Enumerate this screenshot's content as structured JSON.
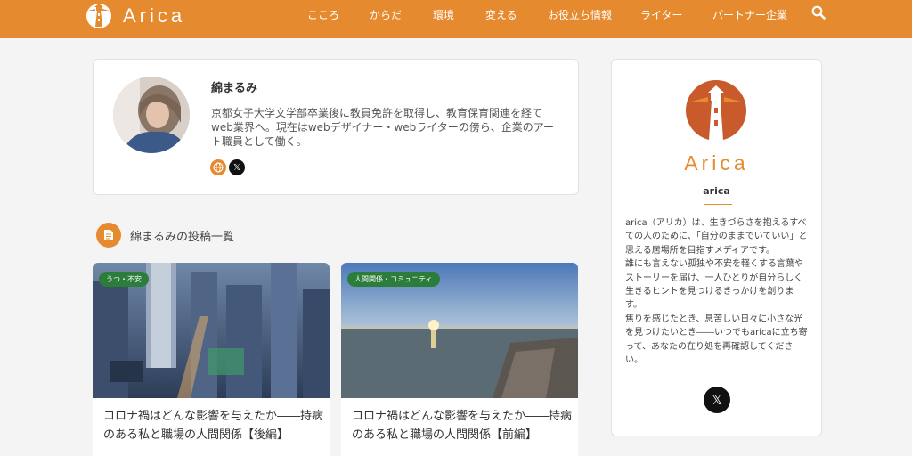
{
  "header": {
    "brand": "Arica",
    "nav": [
      "こころ",
      "からだ",
      "環境",
      "変える",
      "お役立ち情報",
      "ライター",
      "パートナー企業"
    ],
    "search_icon": "search-icon"
  },
  "author": {
    "name": "綿まるみ",
    "bio": "京都女子大学文学部卒業後に教員免許を取得し、教育保育関連を経てweb業界へ。現在はwebデザイナー・webライターの傍ら、企業のアート職員として働く。",
    "icons": [
      "globe-icon",
      "x-icon"
    ]
  },
  "posts_section": {
    "title": "綿まるみの投稿一覧",
    "icon": "document-icon"
  },
  "posts": [
    {
      "category": "うつ・不安",
      "title": "コロナ禍はどんな影響を与えたか――持病のある私と職場の人間関係【後編】"
    },
    {
      "category": "人間関係・コミュニティ",
      "title": "コロナ禍はどんな影響を与えたか――持病のある私と職場の人間関係【前編】"
    }
  ],
  "sidebar": {
    "brand": "Arica",
    "name": "arica",
    "description": "arica（アリカ）は、生きづらさを抱えるすべての人のために、「自分のままでいていい」と思える居場所を目指すメディアです。\n誰にも言えない孤独や不安を軽くする言葉やストーリーを届け、一人ひとりが自分らしく生きるヒントを見つけるきっかけを創ります。\n焦りを感じたとき、息苦しい日々に小さな光を見つけたいとき――いつでもaricaに立ち寄って、あなたの在り処を再確認してください。"
  },
  "colors": {
    "accent": "#e58a2e",
    "category_green": "#2c7d3c",
    "background": "#f4f4f4"
  }
}
